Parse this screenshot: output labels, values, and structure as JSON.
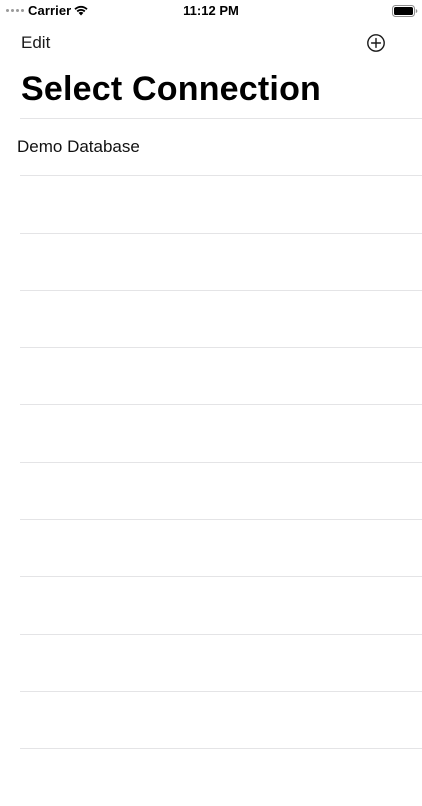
{
  "status_bar": {
    "carrier": "Carrier",
    "time": "11:12 PM",
    "icons": [
      "signal-dots-icon",
      "wifi-icon",
      "battery-icon"
    ]
  },
  "nav": {
    "edit_label": "Edit",
    "add_icon": "plus-circle-icon"
  },
  "title": "Select Connection",
  "connections": [
    {
      "label": "Demo Database"
    },
    {
      "label": ""
    },
    {
      "label": ""
    },
    {
      "label": ""
    },
    {
      "label": ""
    },
    {
      "label": ""
    },
    {
      "label": ""
    },
    {
      "label": ""
    },
    {
      "label": ""
    },
    {
      "label": ""
    },
    {
      "label": ""
    },
    {
      "label": ""
    }
  ],
  "colors": {
    "separator": "#e4e4e6",
    "text": "#000000",
    "background": "#ffffff"
  }
}
